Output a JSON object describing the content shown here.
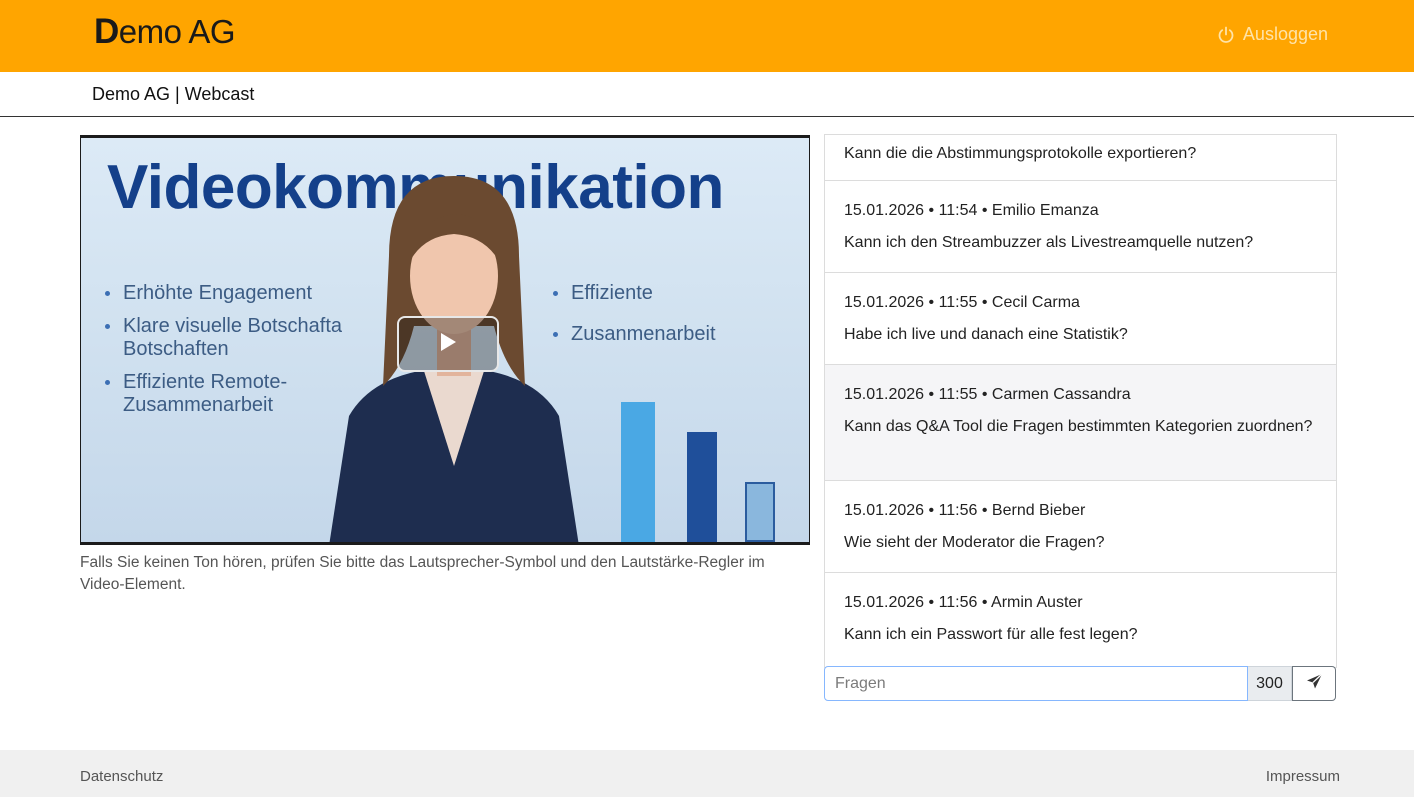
{
  "header": {
    "logo": {
      "first_letter": "D",
      "rest": "emo AG"
    },
    "logout_label": "Ausloggen",
    "logout_icon": "power-icon",
    "subtitle": "Demo AG | Webcast"
  },
  "video": {
    "slide_title": "Videokommunikation",
    "bullets_left": [
      "Erhöhte Engagement",
      "Klare visuelle Botschafta Botschaften",
      "Effiziente Remote-Zusammenarbeit"
    ],
    "bullets_right": [
      "Effiziente",
      "Zusanmenarbeit"
    ],
    "play_icon": "play-icon"
  },
  "hint": "Falls Sie keinen Ton hören, prüfen Sie bitte das Lautsprecher-Symbol und den Lautstärke-Regler im Video-Element.",
  "questions": [
    {
      "meta": "",
      "text": "Kann die die Abstimmungsprotokolle exportieren?"
    },
    {
      "meta": "15.01.2026 • 11:54 • Emilio Emanza",
      "text": "Kann ich den Streambuzzer als Livestreamquelle nutzen?"
    },
    {
      "meta": "15.01.2026 • 11:55 • Cecil Carma",
      "text": "Habe ich live und danach eine Statistik?"
    },
    {
      "meta": "15.01.2026 • 11:55 • Carmen Cassandra",
      "text": "Kann das Q&A Tool die Fragen bestimmten Kategorien zuordnen?"
    },
    {
      "meta": "15.01.2026 • 11:56 • Bernd Bieber",
      "text": "Wie sieht der Moderator die Fragen?"
    },
    {
      "meta": "15.01.2026 • 11:56 • Armin Auster",
      "text": "Kann ich ein Passwort für alle fest legen?"
    }
  ],
  "ask": {
    "placeholder": "Fragen",
    "value": "",
    "char_counter": "300",
    "send_icon": "send-icon"
  },
  "footer": {
    "privacy": "Datenschutz",
    "imprint": "Impressum"
  },
  "colors": {
    "header_bg": "#ffa500",
    "logout_text": "#ffe3a8",
    "slide_title": "#14408a",
    "footer_bg": "#f0f0f0"
  }
}
